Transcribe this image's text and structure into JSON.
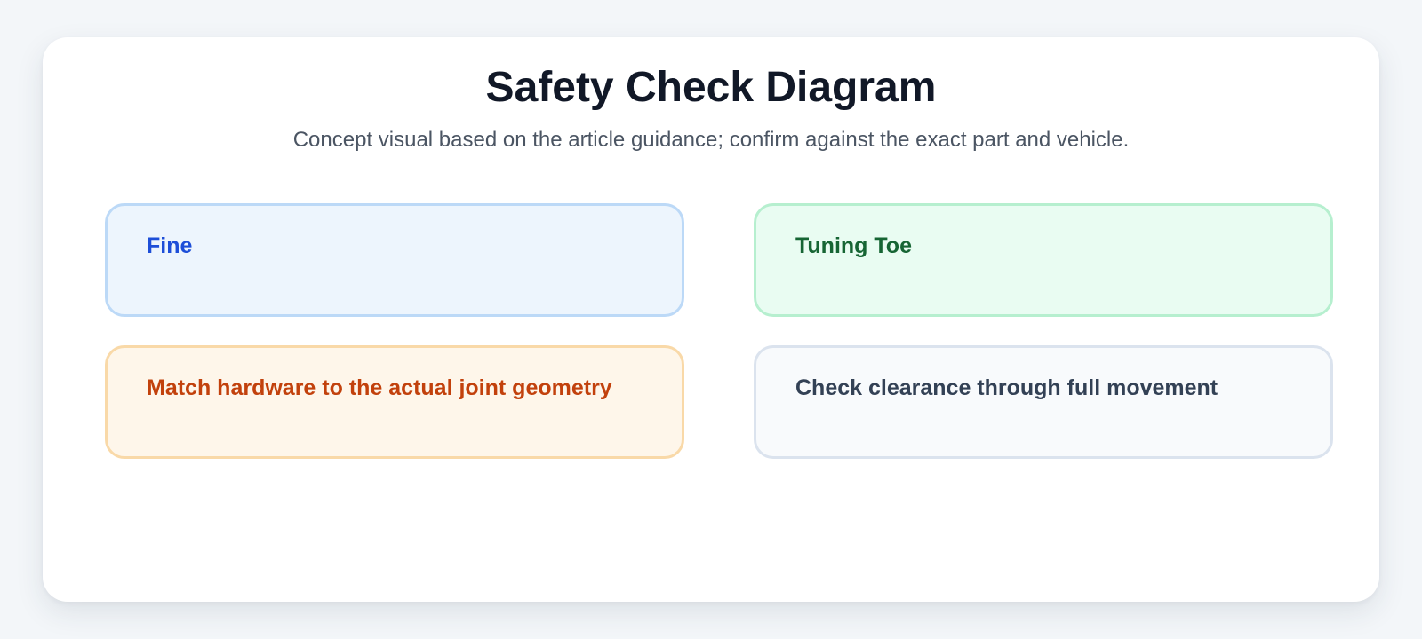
{
  "title": "Safety Check Diagram",
  "subtitle": "Concept visual based on the article guidance; confirm against the exact part and vehicle.",
  "boxes": [
    {
      "label": "Fine",
      "text_color": "#1d4ed8",
      "fill_color": "#edf5fd",
      "border_color": "#bcd9f7"
    },
    {
      "label": "Tuning Toe",
      "text_color": "#166534",
      "fill_color": "#e9fcf2",
      "border_color": "#b6efcf"
    },
    {
      "label": "Match hardware to the actual joint geometry",
      "text_color": "#c2410c",
      "fill_color": "#fef6ea",
      "border_color": "#f9d9a8"
    },
    {
      "label": "Check clearance through full movement",
      "text_color": "#334155",
      "fill_color": "#f8fafc",
      "border_color": "#dbe3ee"
    }
  ]
}
